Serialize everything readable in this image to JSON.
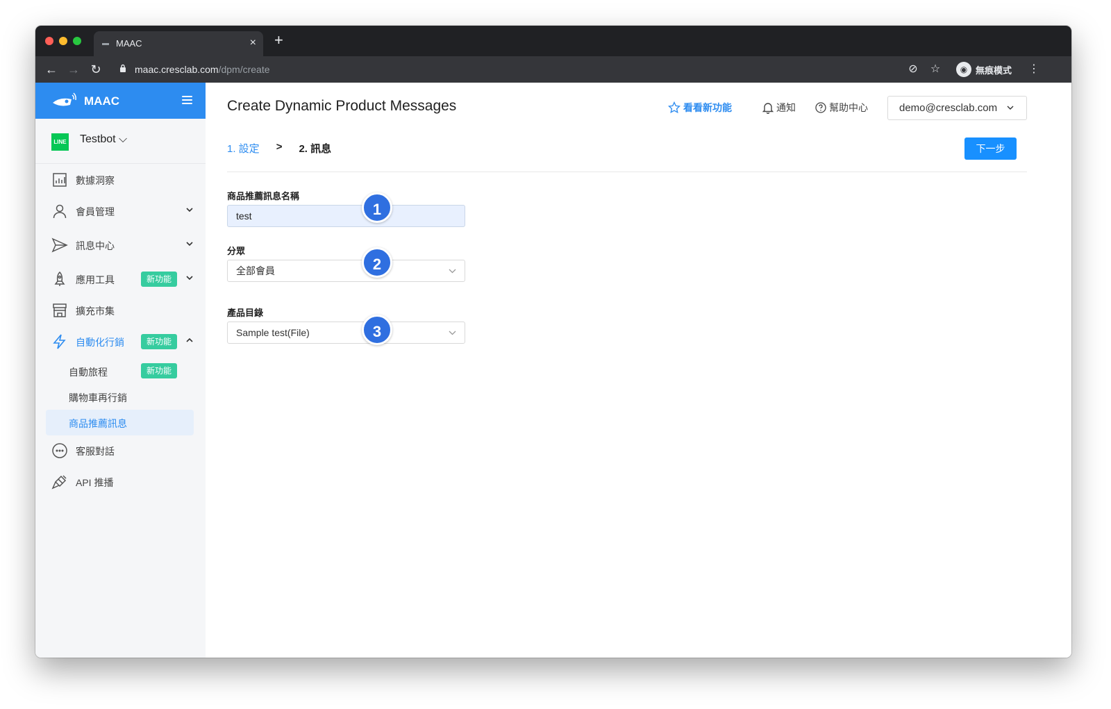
{
  "browser": {
    "tab_title": "MAAC",
    "new_tab": "+",
    "tab_close": "×",
    "url_host": "maac.cresclab.com",
    "url_path": "/dpm/create",
    "incognito_label": "無痕模式"
  },
  "sidebar": {
    "brand": "MAAC",
    "bot_name": "Testbot",
    "line_badge": "LINE",
    "items": [
      {
        "label": "數據洞察",
        "icon": "chart-icon"
      },
      {
        "label": "會員管理",
        "icon": "user-icon"
      },
      {
        "label": "訊息中心",
        "icon": "send-icon"
      },
      {
        "label": "應用工具",
        "icon": "rocket-icon",
        "badge": "新功能"
      },
      {
        "label": "擴充市集",
        "icon": "store-icon"
      },
      {
        "label": "自動化行銷",
        "icon": "lightning-icon",
        "badge": "新功能"
      },
      {
        "label": "客服對話",
        "icon": "chat-icon"
      },
      {
        "label": "API 推播",
        "icon": "plug-icon"
      }
    ],
    "sub_items": [
      {
        "label": "自動旅程",
        "badge": "新功能"
      },
      {
        "label": "購物車再行銷"
      },
      {
        "label": "商品推薦訊息"
      }
    ]
  },
  "header": {
    "title": "Create Dynamic Product Messages",
    "whats_new": "看看新功能",
    "notifications": "通知",
    "help": "幫助中心",
    "user": "demo@cresclab.com"
  },
  "steps": {
    "step1": "1. 設定",
    "separator": ">",
    "step2": "2. 訊息",
    "next_button": "下一步"
  },
  "form": {
    "name_label": "商品推薦訊息名稱",
    "name_value": "test",
    "segment_label": "分眾",
    "segment_value": "全部會員",
    "catalog_label": "產品目錄",
    "catalog_value": "Sample test(File)"
  },
  "callouts": [
    "1",
    "2",
    "3"
  ],
  "colors": {
    "brand_blue": "#2d8cf0",
    "new_badge": "#36cc9f",
    "callout": "#2f6fe0",
    "chat_fab": "#7b4be0"
  }
}
